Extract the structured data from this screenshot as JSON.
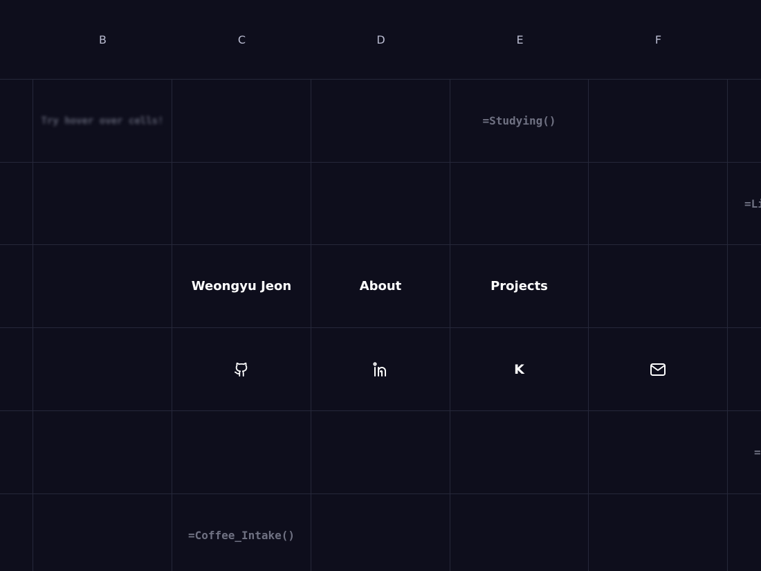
{
  "columns": [
    "B",
    "C",
    "D",
    "E",
    "F"
  ],
  "cells": {
    "hint": "Try hover over cells!",
    "studying": "=Studying()",
    "list_partial": "=Li",
    "eq_partial": "=",
    "coffee": "=Coffee_Intake()"
  },
  "nav": {
    "name": "Weongyu Jeon",
    "about": "About",
    "projects": "Projects"
  },
  "social": {
    "github": "github-icon",
    "linkedin": "linkedin-icon",
    "k_label": "K",
    "mail": "mail-icon"
  },
  "colors": {
    "background": "#0e0e1c",
    "grid": "#26283a",
    "header_text": "#b9bbd0",
    "formula_text": "#6f7182",
    "nav_text": "#ffffff"
  }
}
